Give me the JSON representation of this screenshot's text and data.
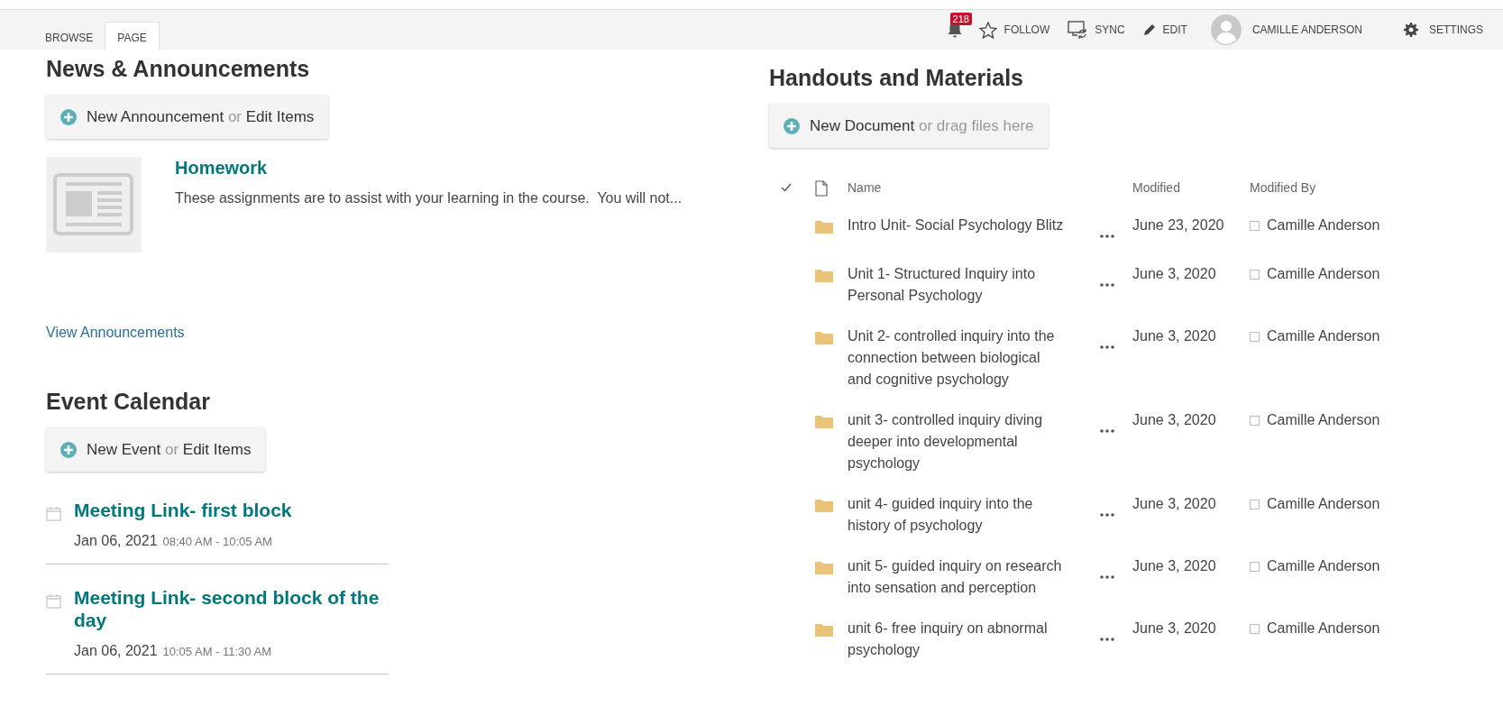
{
  "ribbon": {
    "tabs": [
      {
        "label": "BROWSE",
        "selected": false
      },
      {
        "label": "PAGE",
        "selected": true
      }
    ],
    "notification_count": "218",
    "actions": [
      {
        "kind": "follow",
        "label": "FOLLOW"
      },
      {
        "kind": "sync",
        "label": "SYNC"
      },
      {
        "kind": "edit",
        "label": "EDIT"
      }
    ],
    "user_name": "CAMILLE ANDERSON",
    "settings": "SETTINGS"
  },
  "news": {
    "title": "News & Announcements",
    "action": {
      "primary": "New Announcement",
      "connector": "or",
      "secondary": "Edit Items"
    },
    "items": [
      {
        "title": "Homework",
        "summary": "These assignments are to assist with your learning in the course.  You will not..."
      }
    ],
    "link": "View Announcements"
  },
  "events": {
    "title": "Event Calendar",
    "action": {
      "primary": "New Event",
      "connector": "or",
      "secondary": "Edit Items"
    },
    "items": [
      {
        "title": "Meeting Link- first block",
        "date": "Jan 06, 2021",
        "time": "08:40 AM - 10:05 AM"
      },
      {
        "title": "Meeting Link- second block of the day",
        "date": "Jan 06, 2021",
        "time": "10:05 AM - 11:30 AM"
      }
    ]
  },
  "handouts": {
    "title": "Handouts and Materials",
    "action": {
      "primary": "New Document",
      "connector": "or drag files here"
    },
    "columns": [
      "Name",
      "Modified",
      "Modified By"
    ],
    "rows": [
      {
        "name": "Intro Unit- Social Psychology Blitz",
        "modified": "June 23, 2020",
        "modified_by": "Camille Anderson"
      },
      {
        "name": "Unit 1- Structured Inquiry into Personal Psychology",
        "modified": "June 3, 2020",
        "modified_by": "Camille Anderson"
      },
      {
        "name": "Unit 2- controlled inquiry into the connection between biological and cognitive psychology",
        "modified": "June 3, 2020",
        "modified_by": "Camille Anderson"
      },
      {
        "name": "unit 3- controlled inquiry diving deeper into developmental psychology",
        "modified": "June 3, 2020",
        "modified_by": "Camille Anderson"
      },
      {
        "name": "unit 4- guided inquiry into the history of psychology",
        "modified": "June 3, 2020",
        "modified_by": "Camille Anderson"
      },
      {
        "name": "unit 5- guided inquiry on research into sensation and perception",
        "modified": "June 3, 2020",
        "modified_by": "Camille Anderson"
      },
      {
        "name": "unit 6- free inquiry on abnormal psychology",
        "modified": "June 3, 2020",
        "modified_by": "Camille Anderson"
      }
    ]
  }
}
